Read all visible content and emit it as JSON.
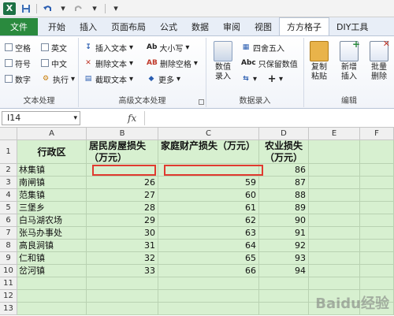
{
  "quick_access": {
    "icons": [
      "excel-logo",
      "save-icon",
      "undo-icon",
      "redo-icon",
      "customize-icon"
    ]
  },
  "tabs": [
    {
      "label": "文件"
    },
    {
      "label": "开始"
    },
    {
      "label": "插入"
    },
    {
      "label": "页面布局"
    },
    {
      "label": "公式"
    },
    {
      "label": "数据"
    },
    {
      "label": "审阅"
    },
    {
      "label": "视图"
    },
    {
      "label": "方方格子"
    },
    {
      "label": "DIY工具"
    }
  ],
  "ribbon": {
    "text_processing": {
      "label": "文本处理",
      "items": [
        "空格",
        "英文",
        "符号",
        "中文",
        "数字",
        "执行"
      ]
    },
    "advanced_text": {
      "label": "高级文本处理",
      "items": [
        "插入文本",
        "删除文本",
        "截取文本",
        "大小写",
        "删除空格",
        "更多"
      ],
      "icon_text": {
        "case": "Ab",
        "del_space": "AB"
      }
    },
    "data_entry": {
      "label": "数据录入",
      "big_button": "数值\n录入",
      "items": [
        "四舍五入",
        "只保留数值"
      ],
      "icon_text": {
        "keep_values": "Abc",
        "plus": "+"
      }
    },
    "edit": {
      "label": "编辑",
      "buttons": [
        {
          "label": "复制\n粘贴"
        },
        {
          "label": "新增\n插入"
        },
        {
          "label": "批量\n删除"
        }
      ]
    }
  },
  "formula_bar": {
    "name_box": "I14",
    "fx": "fx",
    "formula": ""
  },
  "columns": [
    "A",
    "B",
    "C",
    "D",
    "E",
    "F"
  ],
  "rows": [
    "1",
    "2",
    "3",
    "4",
    "5",
    "6",
    "7",
    "8",
    "9",
    "10",
    "11",
    "12",
    "13"
  ],
  "table": {
    "headers": [
      "行政区",
      "居民房屋损失（万元）",
      "家庭财产损失（万元）",
      "农业损失（万元）"
    ],
    "data": [
      [
        "林集镇",
        "",
        "",
        "86"
      ],
      [
        "南闸镇",
        "26",
        "59",
        "87"
      ],
      [
        "范集镇",
        "27",
        "60",
        "88"
      ],
      [
        "三堡乡",
        "28",
        "61",
        "89"
      ],
      [
        "白马湖农场",
        "29",
        "62",
        "90"
      ],
      [
        "张马办事处",
        "30",
        "63",
        "91"
      ],
      [
        "高良涧镇",
        "31",
        "64",
        "92"
      ],
      [
        "仁和镇",
        "32",
        "65",
        "93"
      ],
      [
        "岔河镇",
        "33",
        "66",
        "94"
      ]
    ]
  },
  "watermark": "Baidu经验"
}
